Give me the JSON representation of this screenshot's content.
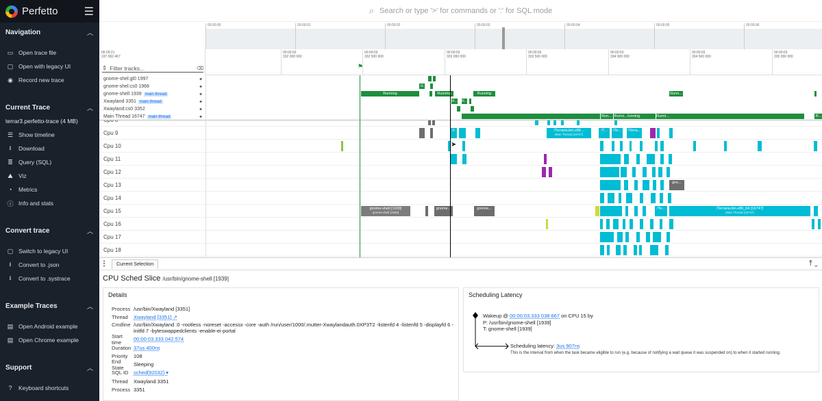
{
  "app": {
    "name": "Perfetto",
    "menu_icon": "hamburger-icon"
  },
  "search": {
    "placeholder": "Search or type '>' for commands or ':' for SQL mode"
  },
  "sidebar": {
    "navigation": {
      "title": "Navigation",
      "items": [
        {
          "label": "Open trace file",
          "icon": "folder-icon"
        },
        {
          "label": "Open with legacy UI",
          "icon": "window-icon"
        },
        {
          "label": "Record new trace",
          "icon": "record-icon"
        }
      ]
    },
    "current_trace": {
      "title": "Current Trace",
      "file": "terrar3.perfetto-trace (4 MB)",
      "items": [
        {
          "label": "Show timeline",
          "icon": "timeline-icon"
        },
        {
          "label": "Download",
          "icon": "download-icon"
        },
        {
          "label": "Query (SQL)",
          "icon": "database-icon"
        },
        {
          "label": "Viz",
          "icon": "viz-icon"
        },
        {
          "label": "Metrics",
          "icon": "metrics-icon"
        },
        {
          "label": "Info and stats",
          "icon": "info-icon"
        }
      ]
    },
    "convert": {
      "title": "Convert trace",
      "items": [
        {
          "label": "Switch to legacy UI",
          "icon": "window-icon"
        },
        {
          "label": "Convert to .json",
          "icon": "download-icon"
        },
        {
          "label": "Convert to .systrace",
          "icon": "download-icon"
        }
      ]
    },
    "examples": {
      "title": "Example Traces",
      "items": [
        {
          "label": "Open Android example",
          "icon": "file-icon"
        },
        {
          "label": "Open Chrome example",
          "icon": "file-icon"
        }
      ]
    },
    "support": {
      "title": "Support",
      "items": [
        {
          "label": "Keyboard shortcuts",
          "icon": "help-icon"
        }
      ]
    }
  },
  "overview": {
    "ticks": [
      "00:00:00",
      "00:00:01",
      "00:00:02",
      "00:00:03",
      "00:00:04",
      "00:00:05",
      "00:00:06"
    ]
  },
  "timeline_header": {
    "start_time": "06:09:21",
    "start_ns": "197.992.467",
    "filter_placeholder": "Filter tracks...",
    "ticks": [
      {
        "t": "00:00:03",
        "ns": "332 000 000"
      },
      {
        "t": "00:00:03",
        "ns": "332 500 000"
      },
      {
        "t": "00:00:03",
        "ns": "333 000 000"
      },
      {
        "t": "00:00:03",
        "ns": "333 500 000"
      },
      {
        "t": "00:00:03",
        "ns": "334 000 000"
      },
      {
        "t": "00:00:03",
        "ns": "334 500 000"
      },
      {
        "t": "00:00:03",
        "ns": "335 000 000"
      }
    ]
  },
  "pinned_tracks": [
    {
      "label": "gnome-shel:gl0 1997",
      "tag": ""
    },
    {
      "label": "gnome-shel:cs0 1968",
      "tag": ""
    },
    {
      "label": "gnome-shell 1939",
      "tag": "main thread"
    },
    {
      "label": "Xwayland 3351",
      "tag": "main thread"
    },
    {
      "label": "Xwayland:cs0 3352",
      "tag": ""
    },
    {
      "label": "Main Thread 16747",
      "tag": "main thread"
    }
  ],
  "pinned_slice_labels": {
    "running": "Running",
    "runni": "Runni...",
    "run": "Run...",
    "runn": "Runn...",
    "r": "R...",
    "g": "G",
    "x": "X"
  },
  "cpu_tracks": [
    "Cpu 8",
    "Cpu 9",
    "Cpu 10",
    "Cpu 11",
    "Cpu 12",
    "Cpu 13",
    "Cpu 14",
    "Cpu 15",
    "Cpu 16",
    "Cpu 17",
    "Cpu 18"
  ],
  "cpu_slice_labels": {
    "terraria": "/Terraria.bin.x86...",
    "terraria_sub": "Main Thread [16747]",
    "slash_t": "/T...",
    "slash_te": "/Te...",
    "slash_terr": "/Terra...",
    "gnome_shell": "gnome-shell [1939]",
    "gnome_shell_sub": "gnome-shell [1939]",
    "gnome_short": "gnome...",
    "gnome_short2": "gnome...",
    "gno": "gno...",
    "terraria_full": "/Terraria.bin.x86_64 [16747]",
    "terraria_full_sub": "Main Thread [16747]",
    "x": "X"
  },
  "details_panel": {
    "tab": "Current Selection",
    "title": "CPU Sched Slice",
    "subtitle": "/usr/bin/gnome-shell [1939]",
    "details_title": "Details",
    "rows": [
      {
        "k": "Process",
        "v": "/usr/bin/Xwayland [3351]"
      },
      {
        "k": "Thread",
        "v": "Xwayland [3351] ↗"
      },
      {
        "k": "Cmdline",
        "v": "/usr/bin/Xwayland :0 -rootless -noreset -accessx -core -auth /run/user/1000/.mutter-Xwaylandauth.0XP3T2 -listenfd 4 -listenfd 5 -displayfd 6 -initfd 7 -byteswappedclients -enable-ei-portal"
      },
      {
        "k": "Start time",
        "v": "00:00:03.333 042 574"
      },
      {
        "k": "Duration",
        "v": "37us 400ns"
      },
      {
        "k": "Priority",
        "v": "108"
      },
      {
        "k": "End State",
        "v": "Sleeping"
      },
      {
        "k": "SQL ID",
        "v": "sched[92032] ▾"
      },
      {
        "k": "Thread",
        "v": "Xwayland 3351"
      },
      {
        "k": "Process",
        "v": "3351"
      }
    ],
    "latency_title": "Scheduling Latency",
    "wakeup_prefix": "Wakeup @",
    "wakeup_time": "00:00:03.333 038 667",
    "wakeup_suffix": "on CPU 15 by",
    "wakeup_p": "P: /usr/bin/gnome-shell [1939]",
    "wakeup_t": "T: gnome-shell [1939]",
    "latency_label": "Scheduling latency:",
    "latency_value": "3us 907ns",
    "latency_note": "This is the interval from when the task became eligible to run (e.g. because of notifying a wait queue it was suspended on) to when it started running."
  },
  "colors": {
    "sidebar": "#19212b",
    "running": "#1e8e3e",
    "cpu_cyan": "#00bcd4",
    "gnome_gray": "#6d6d6d",
    "accent": "#1a73e8"
  }
}
